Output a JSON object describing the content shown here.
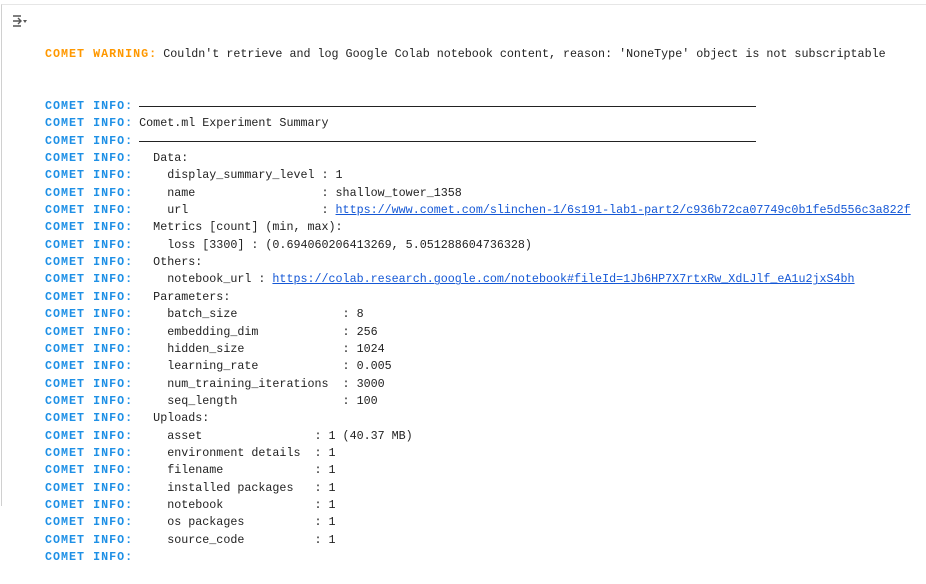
{
  "warning": {
    "label": "COMET WARNING:",
    "text": "Couldn't retrieve and log Google Colab notebook content, reason: 'NoneType' object is not subscriptable"
  },
  "info_label": "COMET INFO:",
  "lines": [
    {
      "type": "sep"
    },
    {
      "text": "Comet.ml Experiment Summary"
    },
    {
      "type": "sep"
    },
    {
      "text": "  Data:"
    },
    {
      "text": "    display_summary_level : 1"
    },
    {
      "text": "    name                  : shallow_tower_1358"
    },
    {
      "text": "    url                   : ",
      "link": "https://www.comet.com/slinchen-1/6s191-lab1-part2/c936b72ca07749c0b1fe5d556c3a822f"
    },
    {
      "text": "  Metrics [count] (min, max):"
    },
    {
      "text": "    loss [3300] : (0.694060206413269, 5.051288604736328)"
    },
    {
      "text": "  Others:"
    },
    {
      "text": "    notebook_url : ",
      "link": "https://colab.research.google.com/notebook#fileId=1Jb6HP7X7rtxRw_XdLJlf_eA1u2jxS4bh"
    },
    {
      "text": "  Parameters:"
    },
    {
      "text": "    batch_size               : 8"
    },
    {
      "text": "    embedding_dim            : 256"
    },
    {
      "text": "    hidden_size              : 1024"
    },
    {
      "text": "    learning_rate            : 0.005"
    },
    {
      "text": "    num_training_iterations  : 3000"
    },
    {
      "text": "    seq_length               : 100"
    },
    {
      "text": "  Uploads:"
    },
    {
      "text": "    asset                : 1 (40.37 MB)"
    },
    {
      "text": "    environment details  : 1"
    },
    {
      "text": "    filename             : 1"
    },
    {
      "text": "    installed packages   : 1"
    },
    {
      "text": "    notebook             : 1"
    },
    {
      "text": "    os packages          : 1"
    },
    {
      "text": "    source_code          : 1"
    },
    {
      "text": ""
    }
  ]
}
